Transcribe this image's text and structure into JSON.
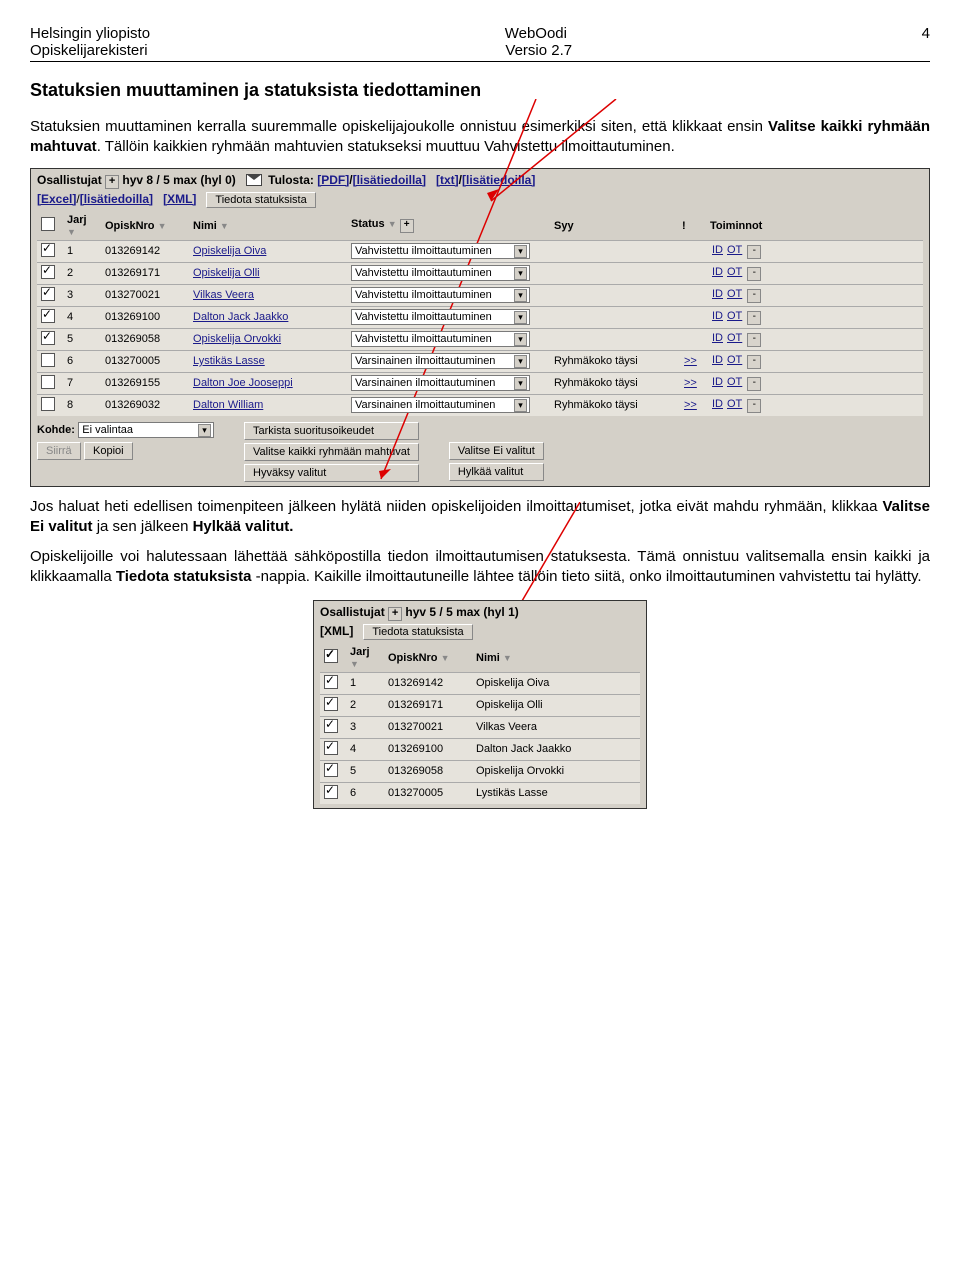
{
  "hdr": {
    "l1": "Helsingin yliopisto",
    "c1": "WebOodi",
    "r1": "4",
    "l2": "Opiskelijarekisteri",
    "c2": "Versio 2.7"
  },
  "h2": "Statuksien muuttaminen ja statuksista tiedottaminen",
  "p1a": "Statuksien muuttaminen kerralla suuremmalle opiskelijajoukolle onnistuu esimerkiksi siten, että klikkaat ensin ",
  "p1b": "Valitse kaikki ryhmään mahtuvat",
  "p1c": ". Tällöin kaikkien ryhmään mahtuvien statukseksi muuttuu Vahvistettu ilmoittautuminen.",
  "shot1": {
    "top1": {
      "osall": "Osallistujat",
      "plus": "+",
      "hyv": "hyv 8 / 5 max (hyl 0)",
      "tulosta": "Tulosta:",
      "pdf": "[PDF]",
      "pdflis": "[lisätiedoilla]",
      "txt": "[txt]",
      "txtlis": "[lisätiedoilla]"
    },
    "top2": {
      "excel": "[Excel]",
      "excellis": "[lisätiedoilla]",
      "xml": "[XML]",
      "tiedota": "Tiedota statuksista"
    },
    "cols": {
      "jarj": "Jarj",
      "opnro": "OpiskNro",
      "nimi": "Nimi",
      "status": "Status",
      "syy": "Syy",
      "warn": "!",
      "toim": "Toiminnot"
    },
    "rows": [
      {
        "ck": true,
        "n": "1",
        "nro": "013269142",
        "nimi": "Opiskelija Oiva",
        "st": "Vahvistettu ilmoittautuminen",
        "syy": "",
        "warn": ""
      },
      {
        "ck": true,
        "n": "2",
        "nro": "013269171",
        "nimi": "Opiskelija Olli",
        "st": "Vahvistettu ilmoittautuminen",
        "syy": "",
        "warn": ""
      },
      {
        "ck": true,
        "n": "3",
        "nro": "013270021",
        "nimi": "Vilkas Veera",
        "st": "Vahvistettu ilmoittautuminen",
        "syy": "",
        "warn": ""
      },
      {
        "ck": true,
        "n": "4",
        "nro": "013269100",
        "nimi": "Dalton Jack Jaakko",
        "st": "Vahvistettu ilmoittautuminen",
        "syy": "",
        "warn": ""
      },
      {
        "ck": true,
        "n": "5",
        "nro": "013269058",
        "nimi": "Opiskelija Orvokki",
        "st": "Vahvistettu ilmoittautuminen",
        "syy": "",
        "warn": ""
      },
      {
        "ck": false,
        "n": "6",
        "nro": "013270005",
        "nimi": "Lystikäs Lasse",
        "st": "Varsinainen ilmoittautuminen",
        "syy": "Ryhmäkoko täysi",
        "warn": ">>"
      },
      {
        "ck": false,
        "n": "7",
        "nro": "013269155",
        "nimi": "Dalton Joe Jooseppi",
        "st": "Varsinainen ilmoittautuminen",
        "syy": "Ryhmäkoko täysi",
        "warn": ">>"
      },
      {
        "ck": false,
        "n": "8",
        "nro": "013269032",
        "nimi": "Dalton William",
        "st": "Varsinainen ilmoittautuminen",
        "syy": "Ryhmäkoko täysi",
        "warn": ">>"
      }
    ],
    "btns": {
      "kohde": "Kohde:",
      "kohdesel": "Ei valintaa",
      "siirra": "Siirrä",
      "kopioi": "Kopioi",
      "b1": "Tarkista suoritusoikeudet",
      "b2": "Valitse kaikki ryhmään mahtuvat",
      "b3": "Hyväksy valitut",
      "b4": "Valitse Ei valitut",
      "b5": "Hylkää valitut"
    },
    "id": "ID",
    "ot": "OT"
  },
  "p2a": "Jos haluat heti edellisen toimenpiteen jälkeen hylätä niiden opiskelijoiden ilmoittautumiset, jotka eivät mahdu ryhmään, klikkaa ",
  "p2b": "Valitse Ei valitut ",
  "p2c": "ja sen jälkeen ",
  "p2d": "Hylkää valitut.",
  "p3a": "Opiskelijoille voi halutessaan lähettää sähköpostilla tiedon ilmoittautumisen statuksesta. Tämä onnistuu valitsemalla ensin kaikki ja klikkaamalla ",
  "p3b": "Tiedota statuksista ",
  "p3c": "-nappia. Kaikille ilmoittautuneille lähtee tällöin tieto siitä, onko ilmoittautuminen vahvistettu tai hylätty.",
  "shot2": {
    "top1": {
      "osall": "Osallistujat",
      "plus": "+",
      "hyv": "hyv 5 / 5 max (hyl 1)"
    },
    "top2": {
      "xml": "[XML]",
      "tiedota": "Tiedota statuksista"
    },
    "cols": {
      "jarj": "Jarj",
      "opnro": "OpiskNro",
      "nimi": "Nimi"
    },
    "rows": [
      {
        "ck": true,
        "n": "1",
        "nro": "013269142",
        "nimi": "Opiskelija Oiva"
      },
      {
        "ck": true,
        "n": "2",
        "nro": "013269171",
        "nimi": "Opiskelija Olli"
      },
      {
        "ck": true,
        "n": "3",
        "nro": "013270021",
        "nimi": "Vilkas Veera"
      },
      {
        "ck": true,
        "n": "4",
        "nro": "013269100",
        "nimi": "Dalton Jack Jaakko"
      },
      {
        "ck": true,
        "n": "5",
        "nro": "013269058",
        "nimi": "Opiskelija Orvokki"
      },
      {
        "ck": true,
        "n": "6",
        "nro": "013270005",
        "nimi": "Lystikäs Lasse"
      }
    ]
  }
}
